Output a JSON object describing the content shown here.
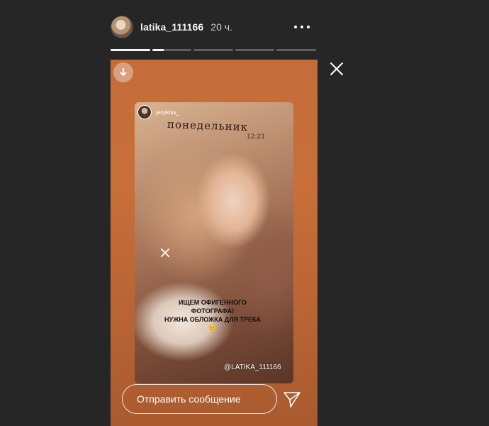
{
  "header": {
    "username": "latika_111166",
    "time": "20 ч."
  },
  "progress": {
    "segments": 5,
    "current_fill": [
      1,
      0.3,
      0,
      0,
      0
    ]
  },
  "story": {
    "photo": {
      "username": "jenykiss_",
      "weekday": "понедельник",
      "time": "12:21",
      "caption": "ИЩЕМ ОФИГЕННОГО ФОТОГРАФА!\nНУЖНА ОБЛОЖКА ДЛЯ ТРЕКА 😊",
      "mention": "@LATIKA_111166"
    },
    "reply_placeholder": "Отправить сообщение"
  },
  "colors": {
    "background": "#262626",
    "story_bg": "#c46d3b",
    "text": "#ffffff"
  },
  "icons": [
    "download-icon",
    "more-icon",
    "close-icon",
    "send-icon",
    "sparkle-icon"
  ]
}
